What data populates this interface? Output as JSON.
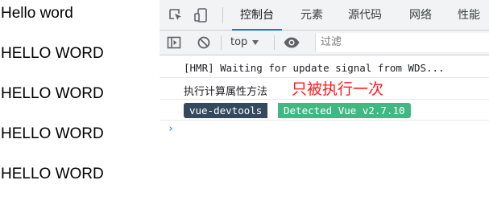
{
  "page": {
    "lines": [
      "Hello word",
      "HELLO WORD",
      "HELLO WORD",
      "HELLO WORD",
      "HELLO WORD"
    ]
  },
  "devtools": {
    "tabs": [
      {
        "label": "控制台",
        "active": true
      },
      {
        "label": "元素",
        "active": false
      },
      {
        "label": "源代码",
        "active": false
      },
      {
        "label": "网络",
        "active": false
      },
      {
        "label": "性能",
        "active": false
      }
    ],
    "toolbar": {
      "context": "top",
      "filter_placeholder": "过滤"
    },
    "console": {
      "messages": [
        {
          "text": "[HMR] Waiting for update signal from WDS..."
        },
        {
          "text": "执行计算属性方法",
          "annotation": "只被执行一次"
        }
      ],
      "badge": {
        "left": "vue-devtools",
        "right": "Detected Vue v2.7.10"
      },
      "prompt": "›"
    }
  },
  "colors": {
    "accent": "#1a73e8",
    "annotation": "#ff1a1a",
    "badge_dark": "#35495e",
    "badge_green": "#41b883"
  }
}
